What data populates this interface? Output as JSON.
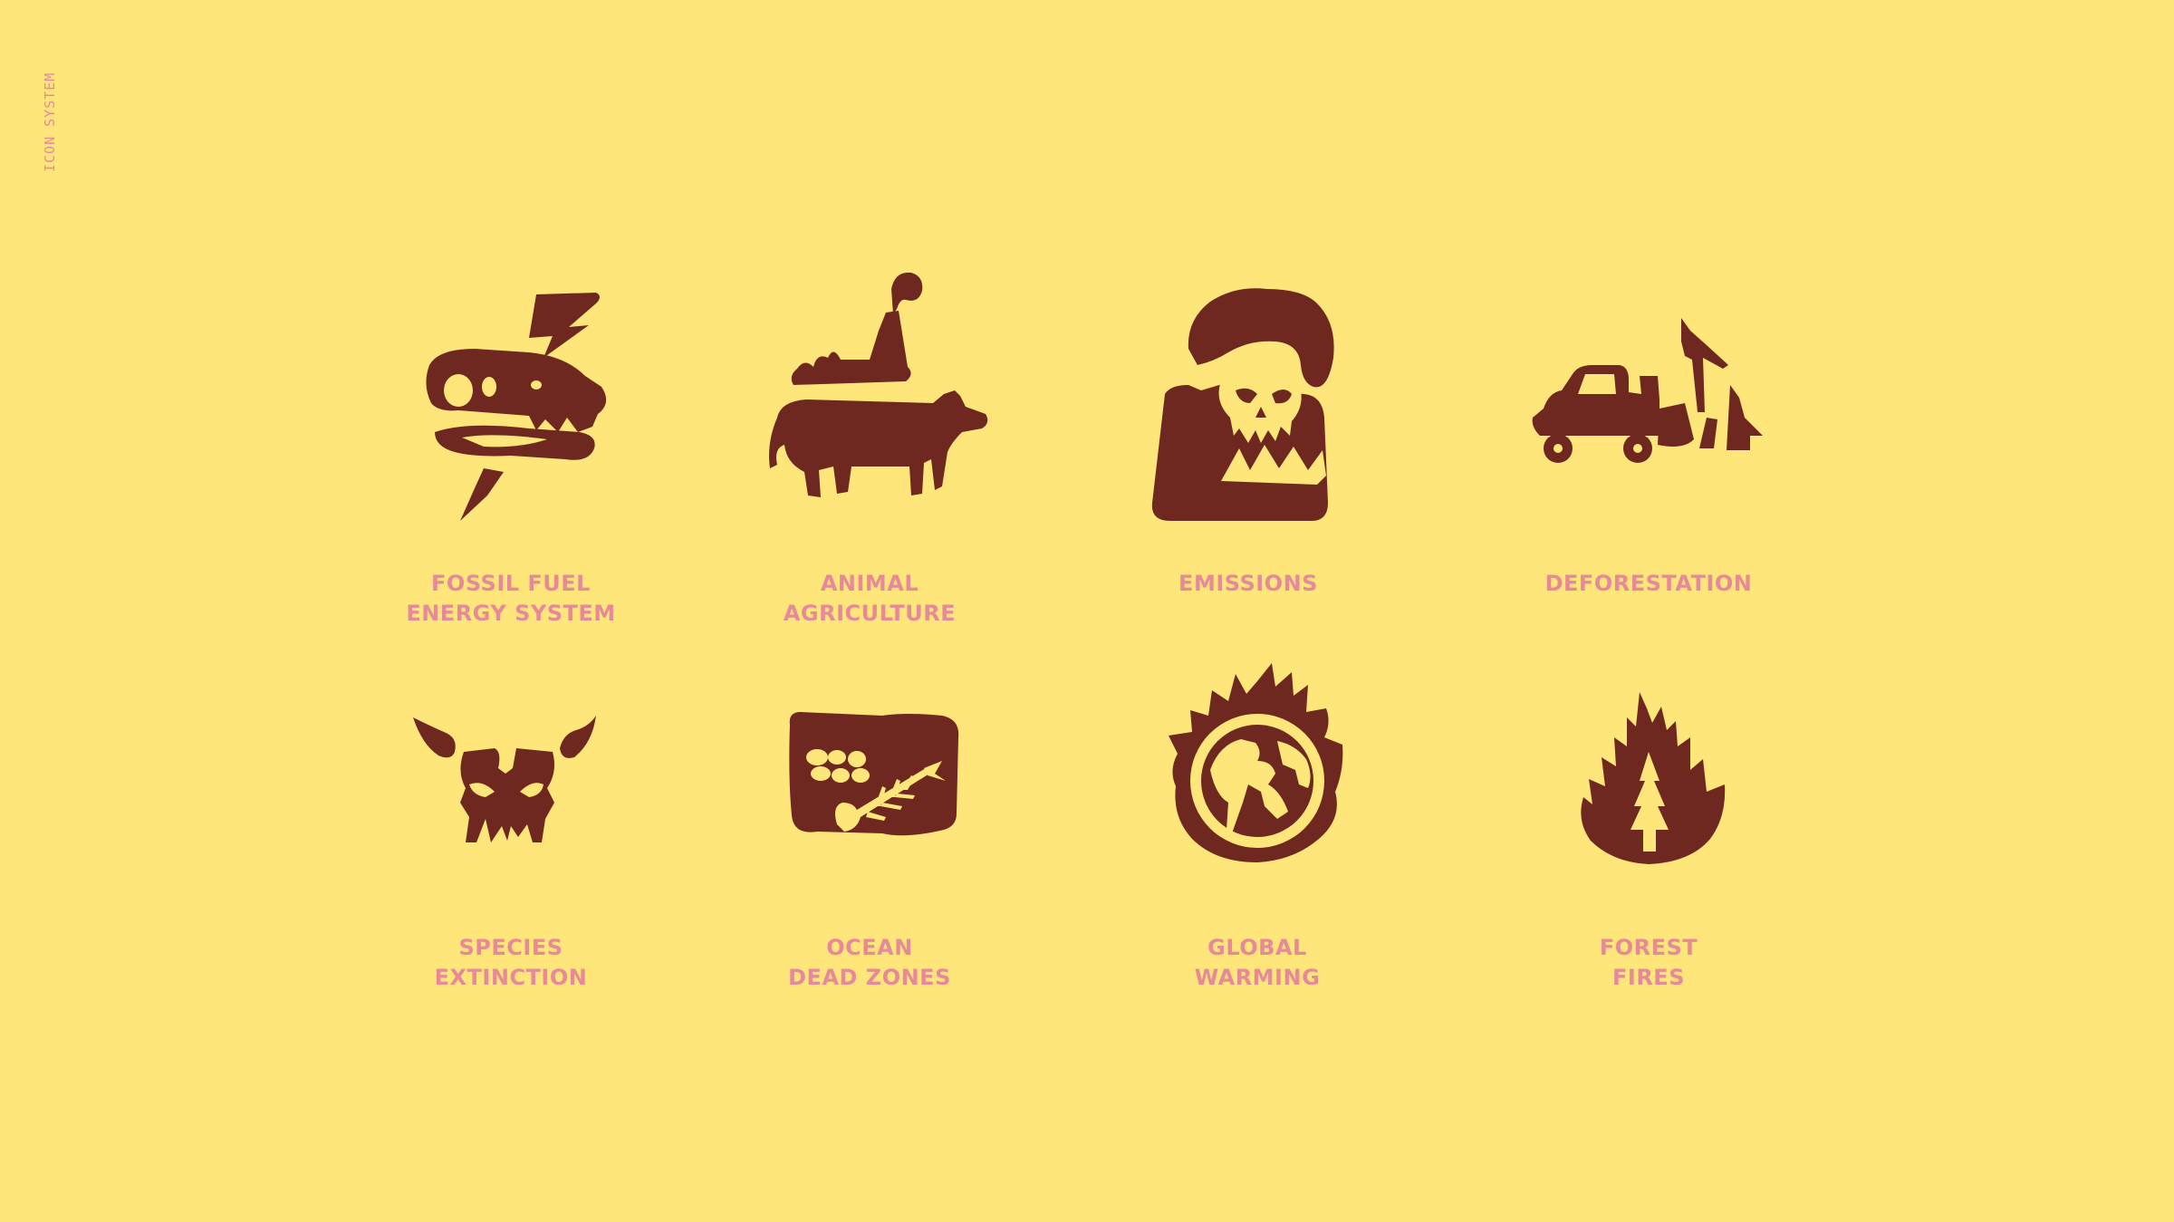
{
  "side_label": "ICON SYSTEM",
  "icon_color": "#6e281f",
  "caption_color": "#e8899a",
  "background_color": "#ffe67a",
  "icons": [
    {
      "icon": "dinosaur-skull-lightning-icon",
      "line1": "FOSSIL FUEL",
      "line2": "ENERGY SYSTEM"
    },
    {
      "icon": "cow-factory-icon",
      "line1": "ANIMAL",
      "line2": "AGRICULTURE"
    },
    {
      "icon": "skull-smoke-icon",
      "line1": "EMISSIONS",
      "line2": ""
    },
    {
      "icon": "truck-felled-trees-icon",
      "line1": "DEFORESTATION",
      "line2": ""
    },
    {
      "icon": "horned-skull-icon",
      "line1": "SPECIES",
      "line2": "EXTINCTION"
    },
    {
      "icon": "fish-skeleton-water-icon",
      "line1": "OCEAN",
      "line2": "DEAD ZONES"
    },
    {
      "icon": "burning-globe-icon",
      "line1": "GLOBAL",
      "line2": "WARMING"
    },
    {
      "icon": "burning-tree-icon",
      "line1": "FOREST",
      "line2": "FIRES"
    }
  ]
}
